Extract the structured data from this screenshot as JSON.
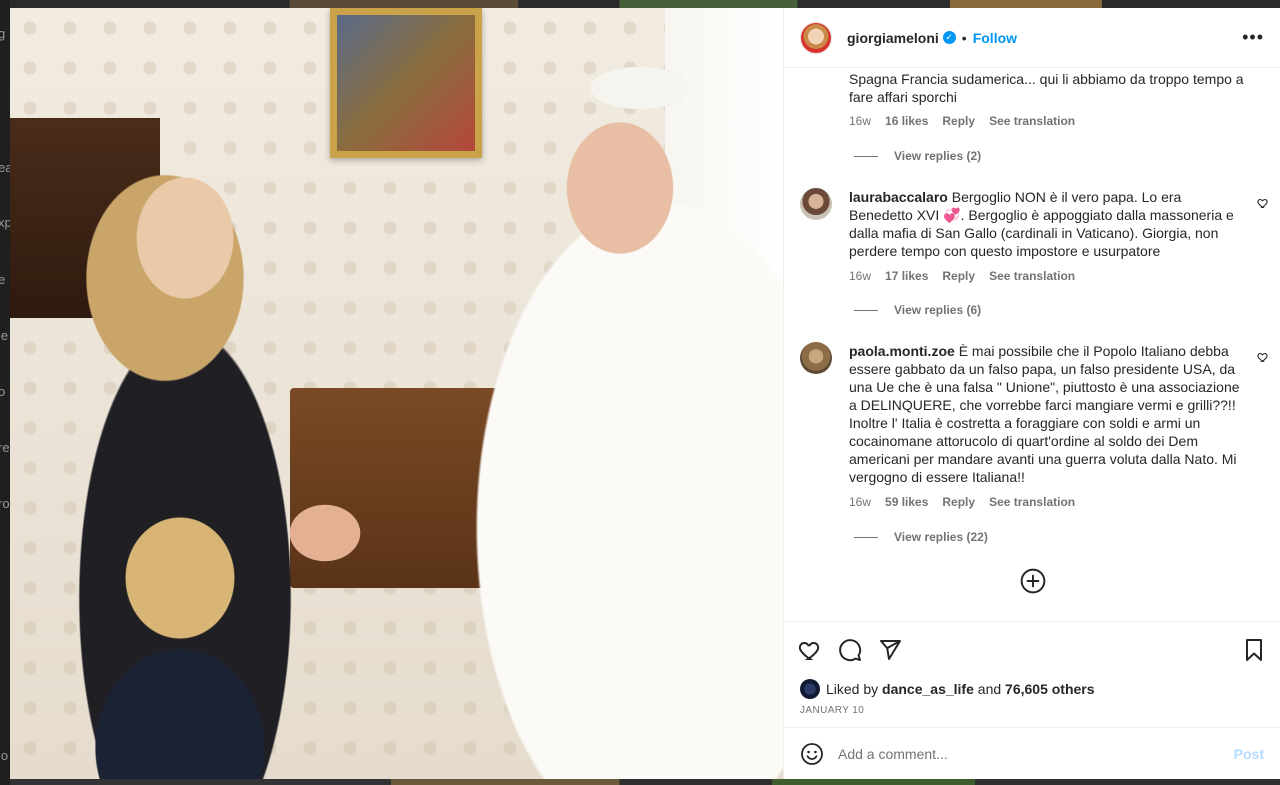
{
  "background_strip": [
    "g",
    "ea",
    "xp",
    "e",
    "le",
    "o",
    "re",
    "ro",
    "lo"
  ],
  "post": {
    "username": "giorgiameloni",
    "verified": true,
    "follow_label": "Follow",
    "separator": "•",
    "more_icon": "more-horizontal-icon"
  },
  "comments": [
    {
      "username": "",
      "text": "Spagna Francia sudamerica... qui li abbiamo da troppo tempo a fare affari sporchi",
      "time": "16w",
      "likes": "16 likes",
      "reply": "Reply",
      "translate": "See translation",
      "view_replies": "View replies (2)"
    },
    {
      "username": "laurabaccalaro",
      "text": "Bergoglio NON è il vero papa. Lo era Benedetto XVI 💞. Bergoglio è appoggiato dalla massoneria e dalla mafia di San Gallo (cardinali in Vaticano). Giorgia, non perdere tempo con questo impostore e usurpatore",
      "time": "16w",
      "likes": "17 likes",
      "reply": "Reply",
      "translate": "See translation",
      "view_replies": "View replies (6)"
    },
    {
      "username": "paola.monti.zoe",
      "text": "È mai possibile che il Popolo Italiano debba essere gabbato da un falso papa, un falso presidente USA, da una Ue che è una falsa \" Unione\", piuttosto è una associazione a DELINQUERE, che vorrebbe farci mangiare vermi e grilli??!! Inoltre l' Italia è costretta a foraggiare con soldi e armi un cocainomane attorucolo di quart'ordine al soldo dei Dem americani per mandare avanti una guerra voluta dalla Nato. Mi vergogno di essere Italiana!!",
      "time": "16w",
      "likes": "59 likes",
      "reply": "Reply",
      "translate": "See translation",
      "view_replies": "View replies (22)"
    }
  ],
  "likes": {
    "prefix": "Liked by",
    "user": "dance_as_life",
    "middle": "and",
    "others": "76,605 others"
  },
  "date": "JANUARY 10",
  "add_comment": {
    "placeholder": "Add a comment...",
    "post_label": "Post"
  },
  "colors": {
    "link_blue": "#0095f6",
    "post_disabled": "#b3dbff",
    "secondary_text": "#737373"
  }
}
